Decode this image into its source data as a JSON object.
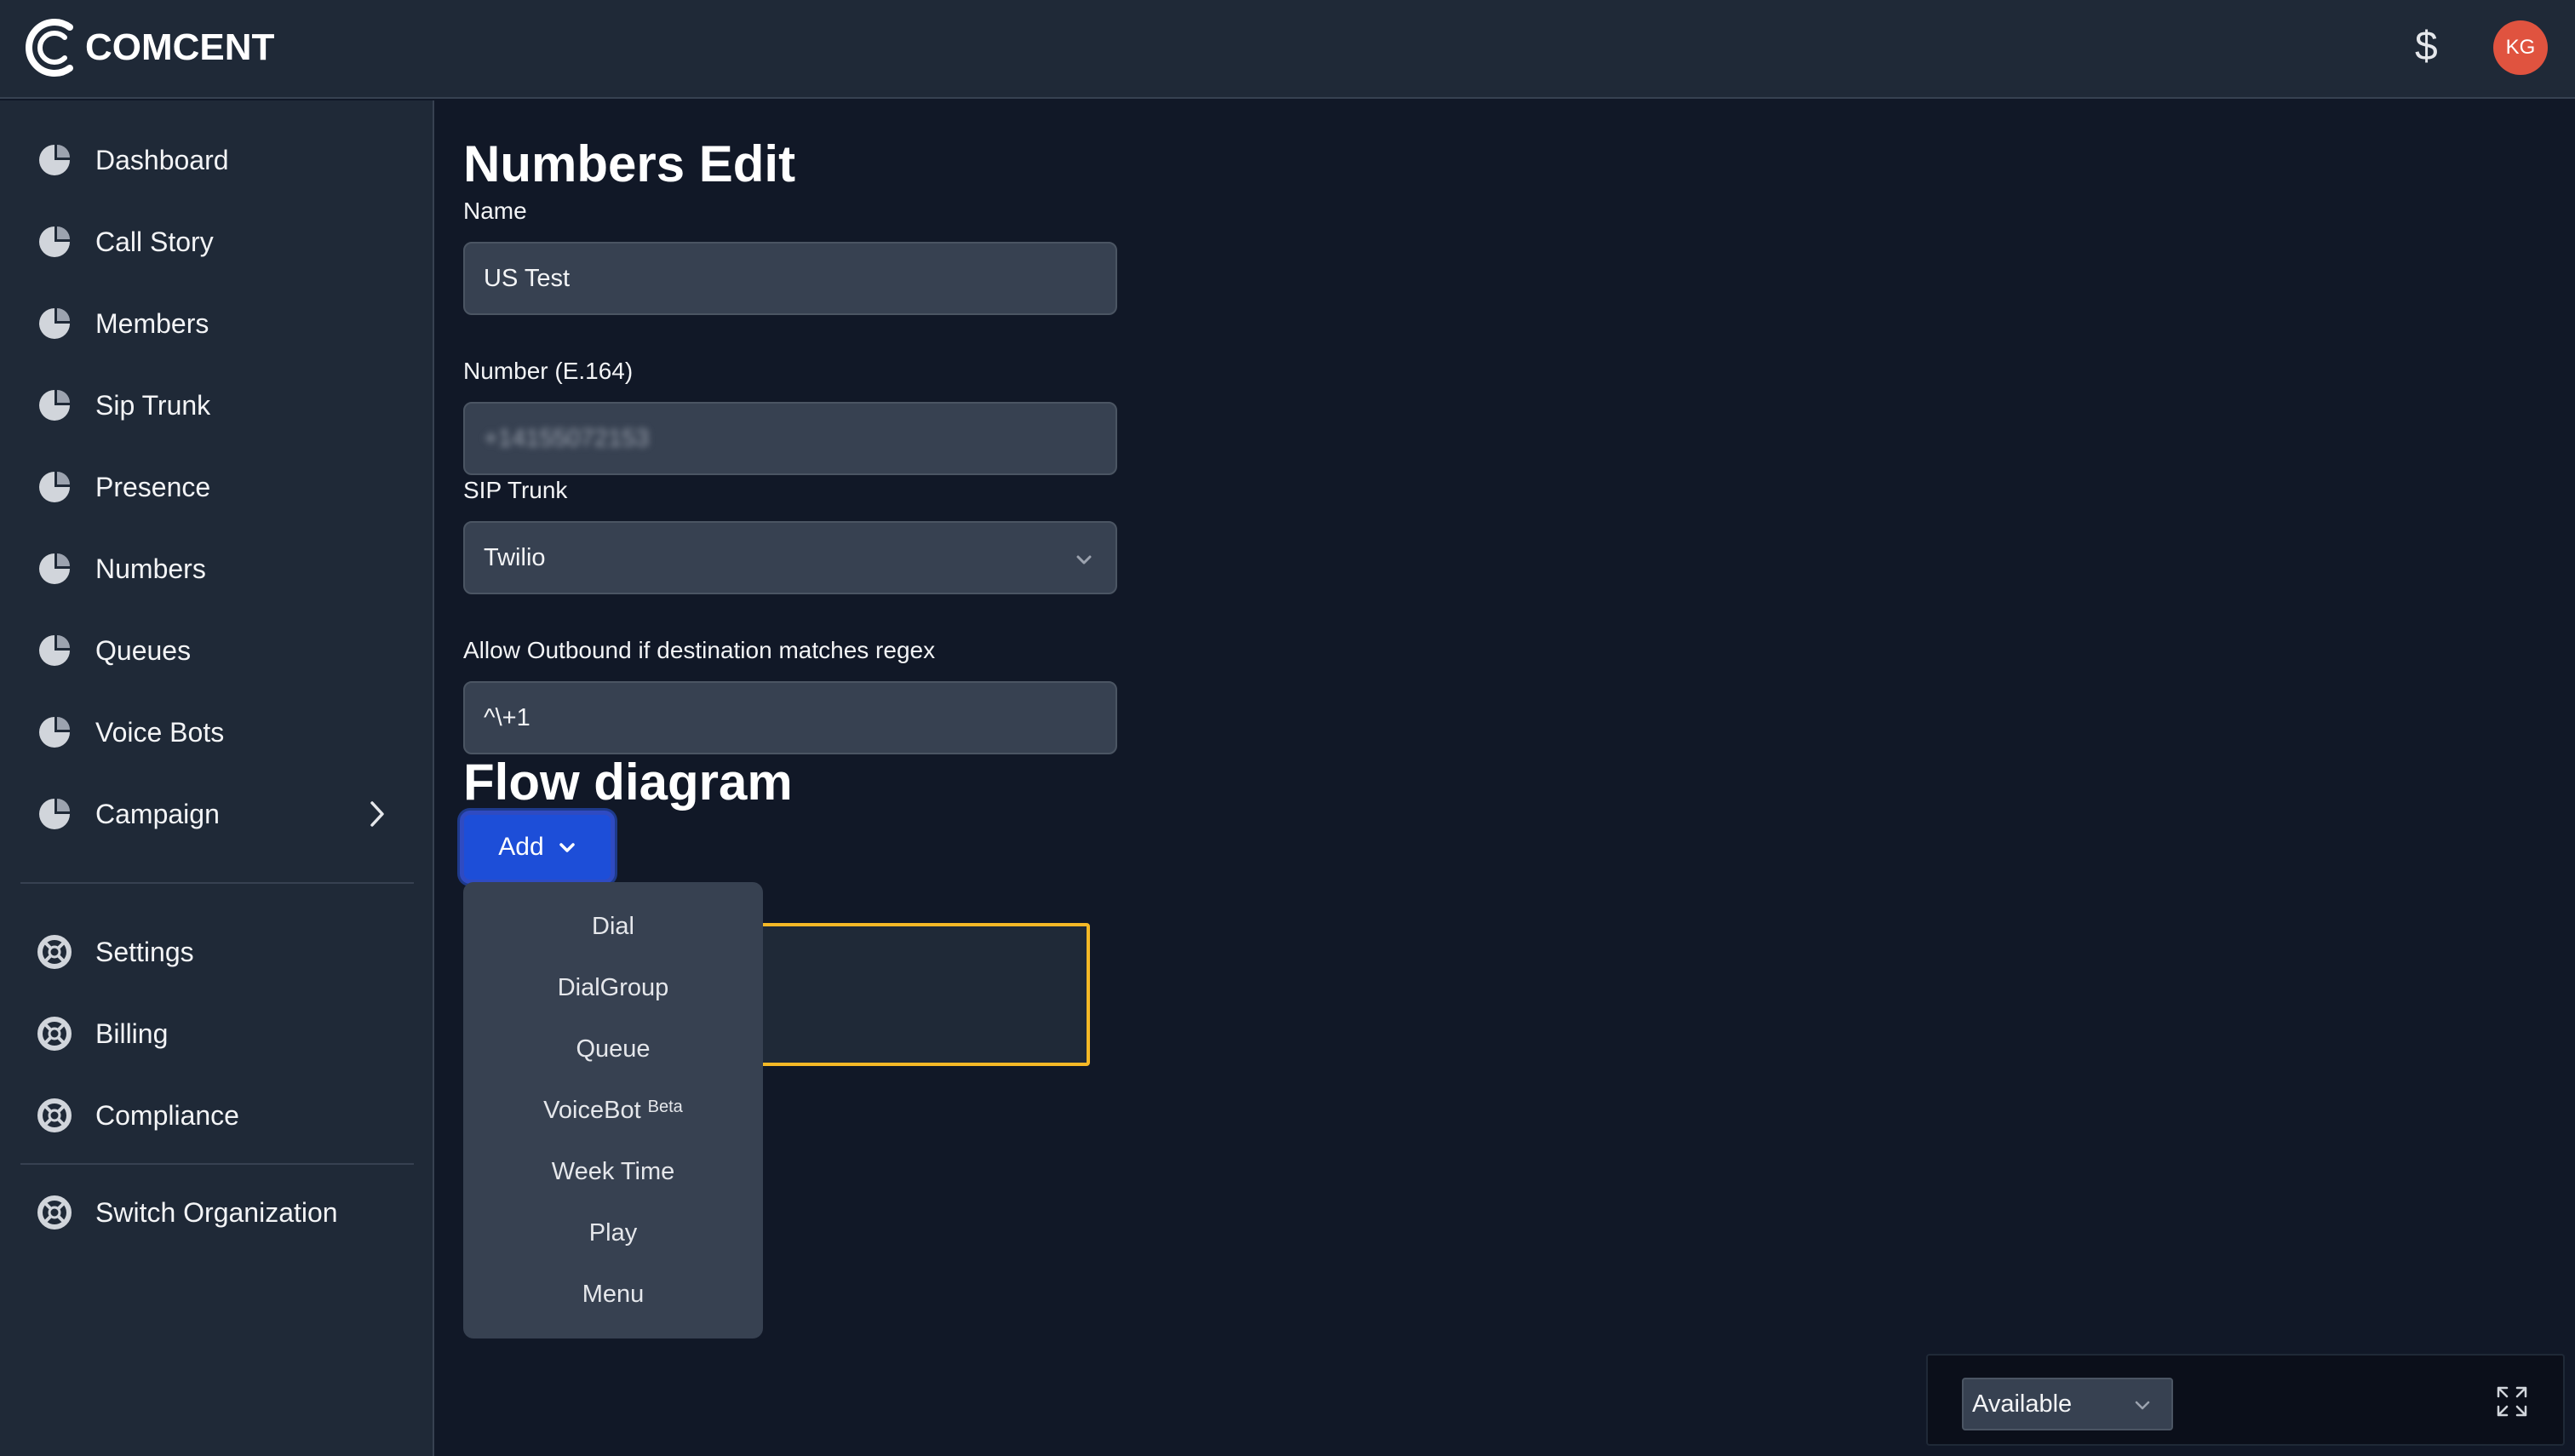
{
  "brand": {
    "name": "COMCENT"
  },
  "header": {
    "currency_symbol": "$",
    "avatar_initials": "KG",
    "avatar_color": "#e0533f"
  },
  "sidebar": {
    "primary": [
      {
        "label": "Dashboard",
        "icon": "pie-chart-icon"
      },
      {
        "label": "Call Story",
        "icon": "pie-chart-icon"
      },
      {
        "label": "Members",
        "icon": "pie-chart-icon"
      },
      {
        "label": "Sip Trunk",
        "icon": "pie-chart-icon"
      },
      {
        "label": "Presence",
        "icon": "pie-chart-icon"
      },
      {
        "label": "Numbers",
        "icon": "pie-chart-icon"
      },
      {
        "label": "Queues",
        "icon": "pie-chart-icon"
      },
      {
        "label": "Voice Bots",
        "icon": "pie-chart-icon"
      },
      {
        "label": "Campaign",
        "icon": "pie-chart-icon",
        "has_submenu": true
      }
    ],
    "secondary": [
      {
        "label": "Settings",
        "icon": "lifebuoy-icon"
      },
      {
        "label": "Billing",
        "icon": "lifebuoy-icon"
      },
      {
        "label": "Compliance",
        "icon": "lifebuoy-icon"
      }
    ],
    "tertiary": [
      {
        "label": "Switch Organization",
        "icon": "lifebuoy-icon"
      }
    ]
  },
  "page": {
    "title": "Numbers Edit",
    "fields": {
      "name": {
        "label": "Name",
        "value": "US Test"
      },
      "number": {
        "label": "Number (E.164)",
        "value": "+14155072153",
        "blurred": true
      },
      "sip_trunk": {
        "label": "SIP Trunk",
        "value": "Twilio"
      },
      "regex": {
        "label": "Allow Outbound if destination matches regex",
        "value": "^\\+1"
      }
    },
    "flow": {
      "title": "Flow diagram",
      "add_label": "Add",
      "menu": [
        {
          "label": "Dial"
        },
        {
          "label": "DialGroup"
        },
        {
          "label": "Queue"
        },
        {
          "label": "VoiceBot",
          "badge": "Beta"
        },
        {
          "label": "Week Time"
        },
        {
          "label": "Play"
        },
        {
          "label": "Menu"
        }
      ]
    }
  },
  "status_widget": {
    "value": "Available"
  },
  "colors": {
    "accent": "#1d4ed8",
    "node_border": "#f5b826",
    "background": "#111827",
    "surface": "#1f2937"
  }
}
